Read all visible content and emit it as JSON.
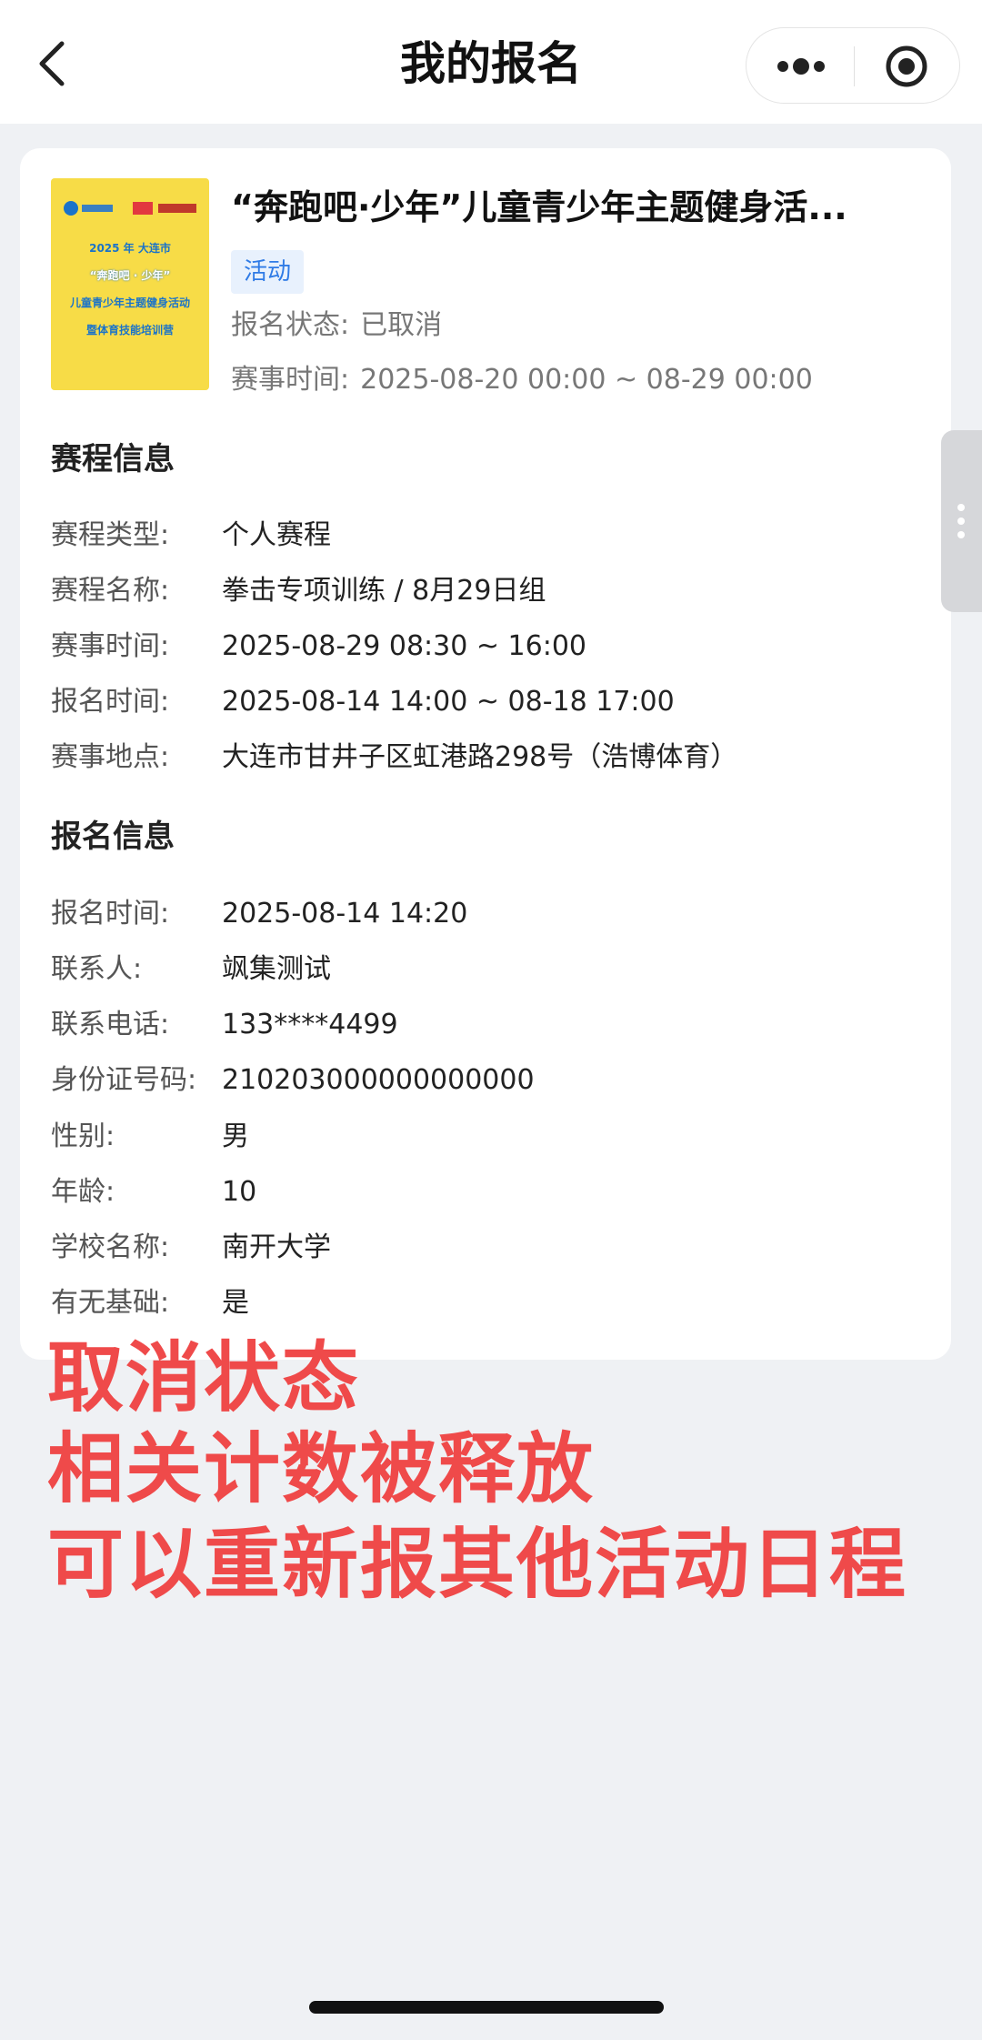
{
  "nav": {
    "title": "我的报名",
    "back_icon": "chevron-left-icon",
    "more_icon": "more-dots-icon",
    "target_icon": "target-circle-icon"
  },
  "event": {
    "title": "“奔跑吧·少年”儿童青少年主题健身活...",
    "tag": "活动",
    "status_label": "报名状态:",
    "status_value": "已取消",
    "time_label": "赛事时间:",
    "time_value": "2025-08-20 00:00 ~ 08-29 00:00",
    "poster_lines": [
      "2025 年 大连市",
      "“奔跑吧 · 少年”",
      "儿童青少年主题健身活动",
      "暨体育技能培训营"
    ]
  },
  "schedule": {
    "title": "赛程信息",
    "rows": [
      {
        "label": "赛程类型:",
        "value": "个人赛程"
      },
      {
        "label": "赛程名称:",
        "value": "拳击专项训练 / 8月29日组"
      },
      {
        "label": "赛事时间:",
        "value": "2025-08-29 08:30 ~ 16:00"
      },
      {
        "label": "报名时间:",
        "value": "2025-08-14 14:00 ~ 08-18 17:00"
      },
      {
        "label": "赛事地点:",
        "value": "大连市甘井子区虹港路298号（浩博体育）"
      }
    ]
  },
  "registration": {
    "title": "报名信息",
    "rows": [
      {
        "label": "报名时间:",
        "value": "2025-08-14 14:20"
      },
      {
        "label": "联系人:",
        "value": "飒集测试"
      },
      {
        "label": "联系电话:",
        "value": "133****4499"
      },
      {
        "label": "身份证号码:",
        "value": "210203000000000000"
      },
      {
        "label": "性别:",
        "value": "男"
      },
      {
        "label": "年龄:",
        "value": "10"
      },
      {
        "label": "学校名称:",
        "value": "南开大学"
      },
      {
        "label": "有无基础:",
        "value": "是"
      }
    ]
  },
  "annotation": {
    "lines": [
      "取消状态",
      "相关计数被释放",
      "可以重新报其他活动日程"
    ],
    "color": "#ef4a4a"
  }
}
